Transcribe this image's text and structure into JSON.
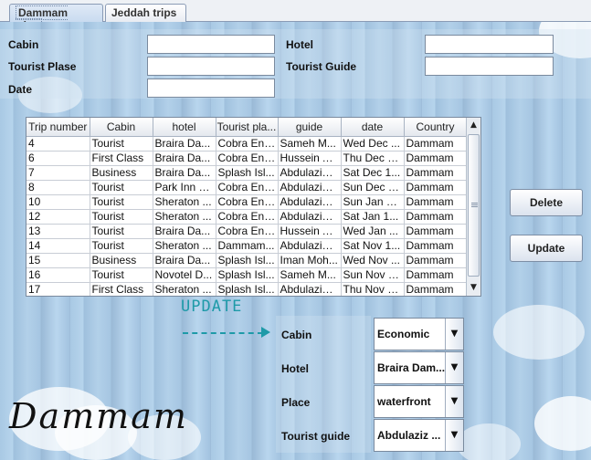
{
  "tabs": [
    {
      "label": "Dammam trips",
      "active": true
    },
    {
      "label": "Jeddah trips",
      "active": false
    }
  ],
  "form": {
    "cabin_label": "Cabin",
    "tourist_place_label": "Tourist Plase",
    "date_label": "Date",
    "hotel_label": "Hotel",
    "tourist_guide_label": "Tourist Guide",
    "cabin_value": "",
    "tourist_place_value": "",
    "date_value": "",
    "hotel_value": "",
    "tourist_guide_value": ""
  },
  "table": {
    "columns": [
      "Trip number",
      "Cabin",
      "hotel",
      "Tourist pla...",
      "guide",
      "date",
      "Country"
    ],
    "rows": [
      [
        "4",
        "Tourist",
        "Braira Da...",
        "Cobra Ent...",
        "Sameh M...",
        "Wed Dec ...",
        "Dammam"
      ],
      [
        "6",
        "First Class",
        "Braira Da...",
        "Cobra Ent...",
        "Hussein A...",
        "Thu Dec 1...",
        "Dammam"
      ],
      [
        "7",
        "Business",
        "Braira Da...",
        "Splash Isl...",
        "Abdulaziz ...",
        "Sat Dec 1...",
        "Dammam"
      ],
      [
        "8",
        "Tourist",
        "Park Inn b...",
        "Cobra Ent...",
        "Abdulaziz ...",
        "Sun Dec 1...",
        "Dammam"
      ],
      [
        "10",
        "Tourist",
        "Sheraton ...",
        "Cobra Ent...",
        "Abdulaziz ...",
        "Sun Jan 1...",
        "Dammam"
      ],
      [
        "12",
        "Tourist",
        "Sheraton ...",
        "Cobra Ent...",
        "Abdulaziz ...",
        "Sat Jan 1...",
        "Dammam"
      ],
      [
        "13",
        "Tourist",
        "Braira Da...",
        "Cobra Ent...",
        "Hussein A...",
        "Wed Jan ...",
        "Dammam"
      ],
      [
        "14",
        "Tourist",
        "Sheraton ...",
        "Dammam...",
        "Abdulaziz ...",
        "Sat Nov 1...",
        "Dammam"
      ],
      [
        "15",
        "Business",
        "Braira Da...",
        "Splash Isl...",
        "Iman Moh...",
        "Wed Nov ...",
        "Dammam"
      ],
      [
        "16",
        "Tourist",
        "Novotel D...",
        "Splash Isl...",
        "Sameh M...",
        "Sun Nov 1...",
        "Dammam"
      ],
      [
        "17",
        "First Class",
        "Sheraton ...",
        "Splash Isl...",
        "Abdulaziz ...",
        "Thu Nov 1...",
        "Dammam"
      ]
    ]
  },
  "buttons": {
    "delete": "Delete",
    "update": "Update"
  },
  "update_section": {
    "heading": "UPDATE",
    "cabin_label": "Cabin",
    "hotel_label": "Hotel",
    "place_label": "Place",
    "guide_label": "Tourist guide",
    "cabin_value": "Economic",
    "hotel_value": "Braira Dam...",
    "place_value": "waterfront",
    "guide_value": "Abdulaziz ..."
  },
  "city_title": "Dammam",
  "colors": {
    "accent": "#1e9aa8",
    "background": "#a9c9e4"
  },
  "icons": {
    "dropdown": "chevron-down-icon",
    "scroll_up": "arrow-up-icon",
    "scroll_down": "arrow-down-icon"
  }
}
